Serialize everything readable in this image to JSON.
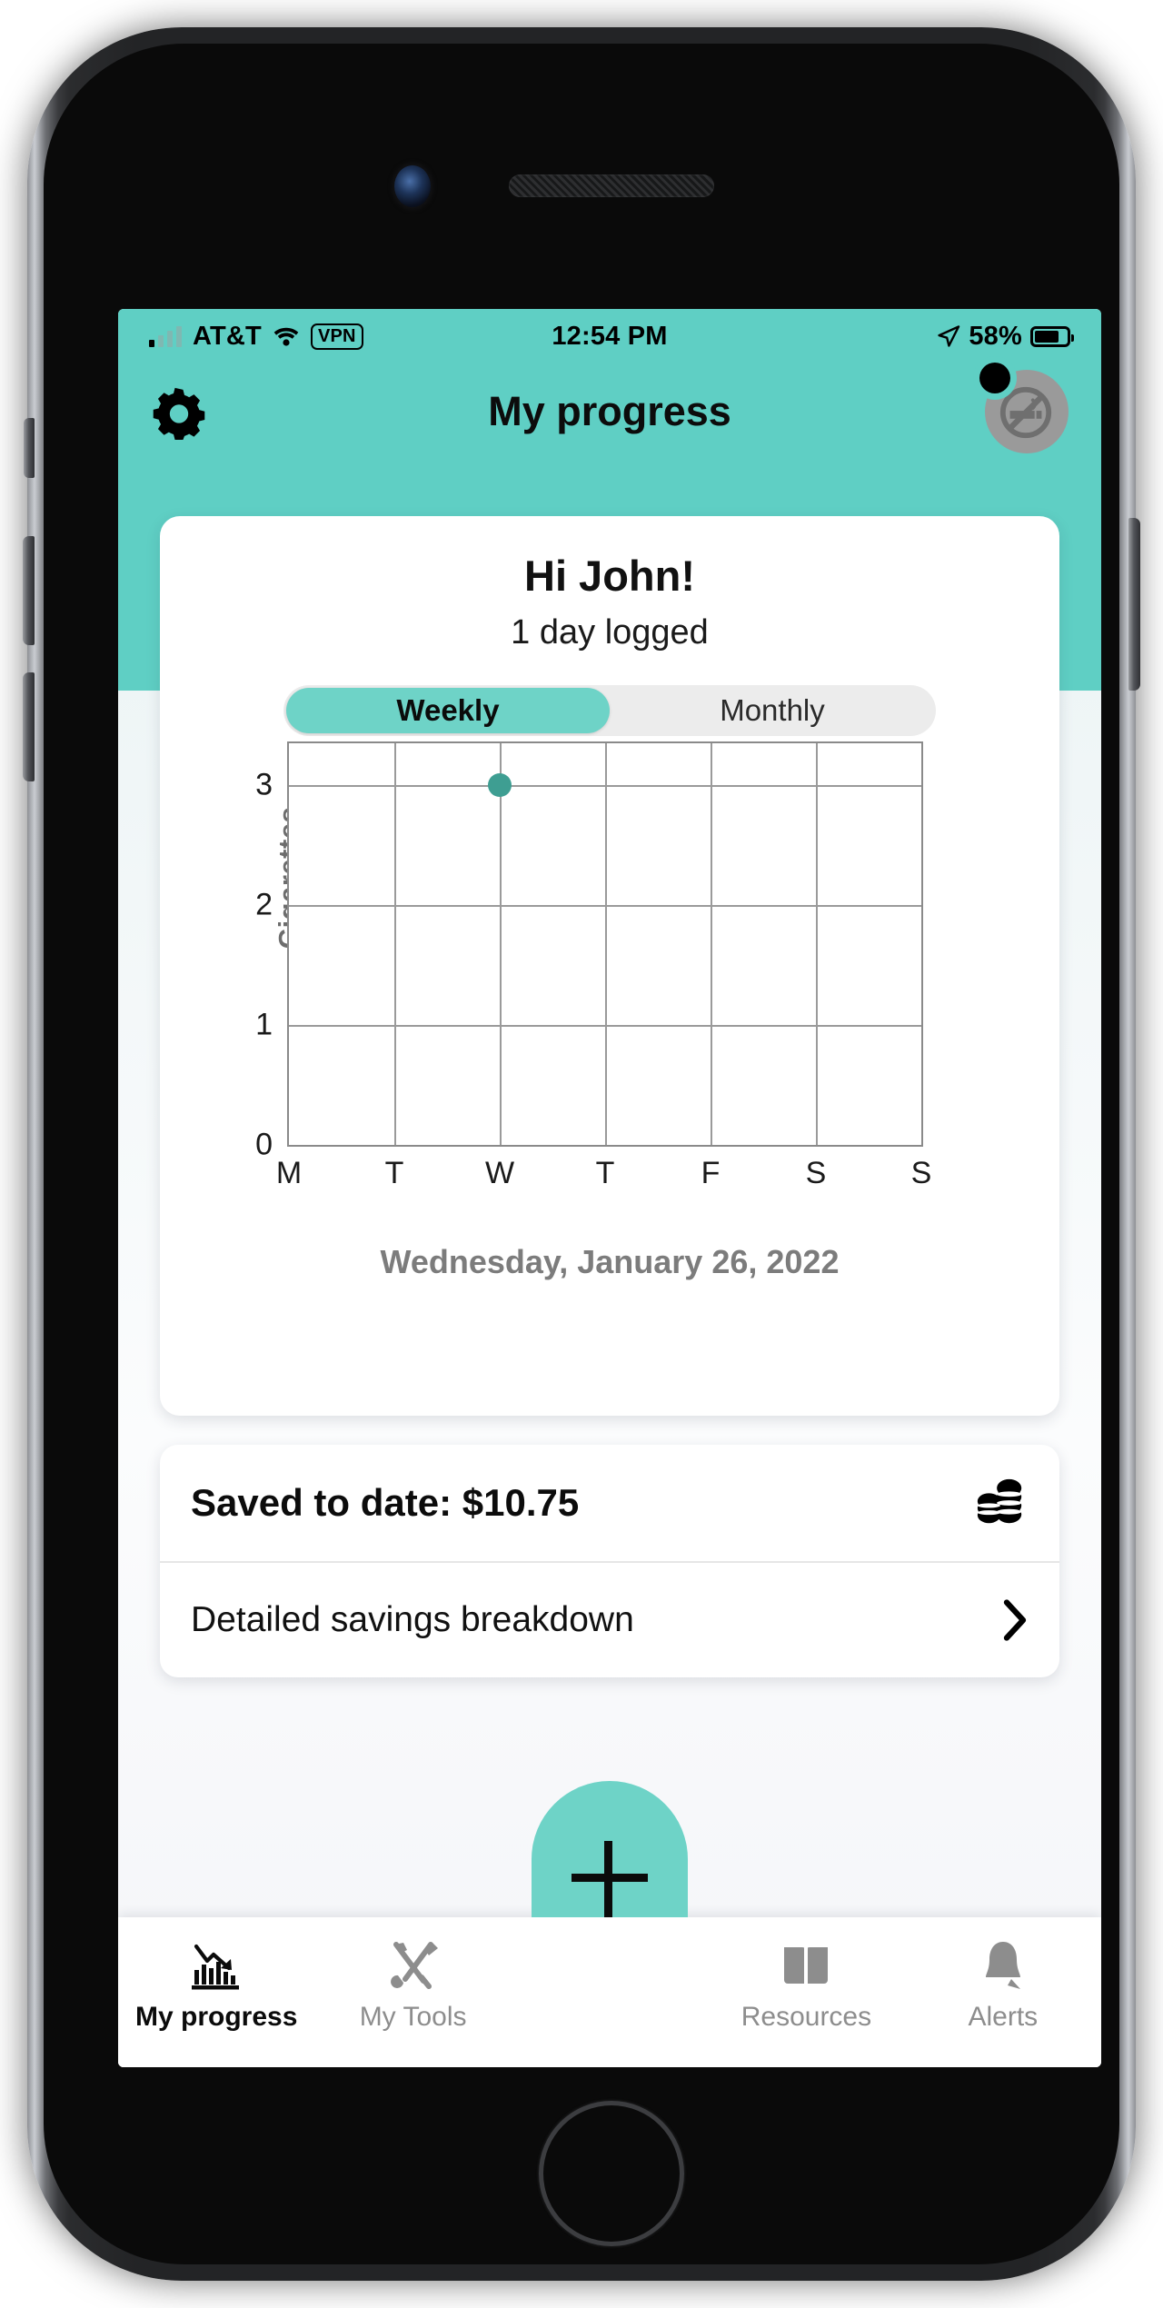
{
  "status_bar": {
    "carrier": "AT&T",
    "vpn": "VPN",
    "time": "12:54 PM",
    "battery_percent": "58%",
    "signal_icon": "signal-bars-icon",
    "wifi_icon": "wifi-icon",
    "location_icon": "location-arrow-icon",
    "battery_icon": "battery-icon"
  },
  "header": {
    "title": "My progress",
    "settings_icon": "gear-icon",
    "avatar_icon": "no-smoking-avatar-icon",
    "notification_dot": "notification-dot"
  },
  "progress_card": {
    "greeting": "Hi John!",
    "days_logged": "1 day logged",
    "segments": [
      {
        "label": "Weekly",
        "active": true
      },
      {
        "label": "Monthly",
        "active": false
      }
    ],
    "date_caption": "Wednesday, January 26, 2022"
  },
  "chart_data": {
    "type": "scatter",
    "title": "",
    "xlabel": "",
    "ylabel": "Cigarettes",
    "categories": [
      "M",
      "T",
      "W",
      "T",
      "F",
      "S",
      "S"
    ],
    "x_tick_labels": [
      "M",
      "T",
      "W",
      "T",
      "F",
      "S",
      "S"
    ],
    "y_tick_labels": [
      "0",
      "1",
      "2",
      "3"
    ],
    "ylim": [
      0,
      3.35
    ],
    "y_ticks": [
      0,
      1,
      2,
      3
    ],
    "grid": true,
    "legend": "none",
    "point_color": "#3e9e92",
    "series": [
      {
        "name": "Cigarettes per day",
        "points": [
          {
            "x": "W",
            "x_index": 2,
            "y": 3
          }
        ]
      }
    ]
  },
  "savings": {
    "total_label": "Saved to date: $10.75",
    "total_amount": "$10.75",
    "coins_icon": "coins-stack-icon",
    "detail_label": "Detailed savings breakdown",
    "chevron_icon": "chevron-right-icon"
  },
  "tab_bar": {
    "tabs": [
      {
        "label": "My progress",
        "icon": "declining-chart-icon",
        "active": true
      },
      {
        "label": "My Tools",
        "icon": "tools-icon",
        "active": false
      },
      {
        "label": "Resources",
        "icon": "open-book-icon",
        "active": false
      },
      {
        "label": "Alerts",
        "icon": "bell-icon",
        "active": false
      }
    ],
    "add_button_icon": "plus-icon"
  },
  "colors": {
    "accent_teal": "#5fcfc4",
    "segment_teal": "#6ed3c7",
    "data_point_teal": "#3e9e92",
    "muted_gray": "#8d8d8d",
    "caption_gray": "#7c7c7c"
  }
}
